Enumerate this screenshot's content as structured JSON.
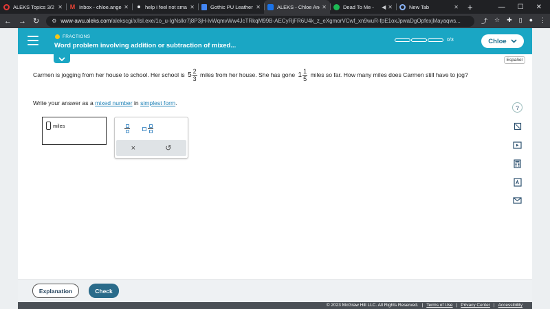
{
  "browser": {
    "tabs": [
      {
        "title": "ALEKS Topics 3/2",
        "icon": "aleks-ring-icon",
        "color": "#e53935"
      },
      {
        "title": "Inbox - chloe.ange",
        "icon": "gmail-icon",
        "color": "#ea4335"
      },
      {
        "title": "help i feel not sma",
        "icon": "brainly-icon",
        "color": "#3c4043"
      },
      {
        "title": "Gothic PU Leather",
        "icon": "docs-icon",
        "color": "#4285f4"
      },
      {
        "title": "ALEKS - Chloe Ang",
        "icon": "aleks-icon",
        "color": "#1a73e8"
      },
      {
        "title": "Dead To Me -",
        "icon": "spotify-icon",
        "color": "#1db954"
      },
      {
        "title": "New Tab",
        "icon": "chrome-icon",
        "color": "#8ab4f8"
      }
    ],
    "new_tab_glyph": "+",
    "url_host": "www-awu.aleks.com",
    "url_path": "/alekscgi/x/Isl.exe/1o_u-IgNslkr7j8P3jH-lvWqmvWw4JcTRkqM99B-AECyRjFR6U4k_z_eXgmorVCwf_xn9wuR-fpE1oxJpwaDgOpfexjMayaqws..."
  },
  "header": {
    "topic_label": "FRACTIONS",
    "topic_title": "Word problem involving addition or subtraction of mixed...",
    "progress_text": "0/3",
    "user_name": "Chloe"
  },
  "espanol_label": "Español",
  "problem": {
    "part1": "Carmen is jogging from her house to school. Her school is",
    "mixed1": {
      "whole": "5",
      "num": "2",
      "den": "3"
    },
    "part2": "miles from her house. She has gone",
    "mixed2": {
      "whole": "1",
      "num": "1",
      "den": "5"
    },
    "part3": "miles so far. How many miles does Carmen still have to jog?",
    "instruction_pre": "Write your answer as a",
    "link1": "mixed number",
    "instruction_mid": "in",
    "link2": "simplest form",
    "instruction_end": "."
  },
  "answer": {
    "units": "miles"
  },
  "palette": {
    "clear_glyph": "×",
    "undo_glyph": "↺"
  },
  "footer": {
    "explanation_label": "Explanation",
    "check_label": "Check",
    "copyright": "© 2023 McGraw Hill LLC. All Rights Reserved.",
    "terms": "Terms of Use",
    "privacy": "Privacy Center",
    "accessibility": "Accessibility"
  },
  "colors": {
    "header_teal": "#1aa6c4",
    "check_button": "#2a6b8a",
    "link_blue": "#1a7fb5"
  }
}
